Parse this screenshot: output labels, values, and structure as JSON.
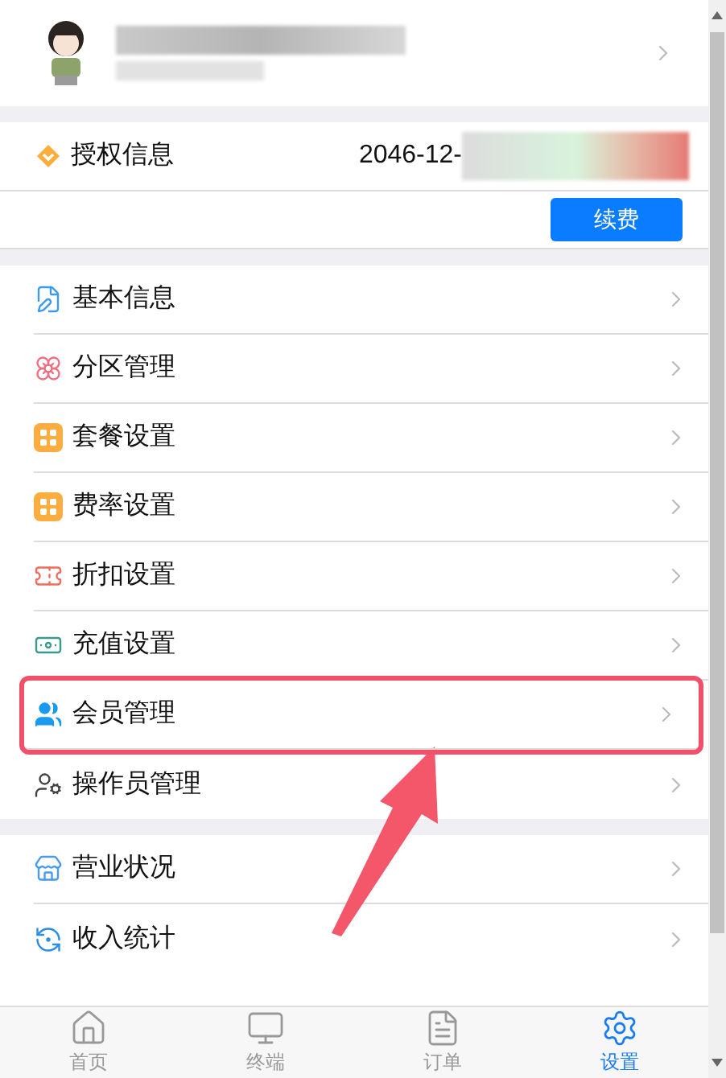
{
  "license": {
    "label": "授权信息",
    "expiry": "2046-12-",
    "button": "续费"
  },
  "menu_groups": [
    {
      "items": [
        {
          "label": "基本信息",
          "highlighted": false
        },
        {
          "label": "分区管理",
          "highlighted": false
        },
        {
          "label": "套餐设置",
          "highlighted": false
        },
        {
          "label": "费率设置",
          "highlighted": false
        },
        {
          "label": "折扣设置",
          "highlighted": false
        },
        {
          "label": "充值设置",
          "highlighted": false
        },
        {
          "label": "会员管理",
          "highlighted": true
        },
        {
          "label": "操作员管理",
          "highlighted": false
        }
      ]
    },
    {
      "items": [
        {
          "label": "营业状况",
          "highlighted": false
        },
        {
          "label": "收入统计",
          "highlighted": false
        }
      ]
    }
  ],
  "tabs": [
    {
      "label": "首页",
      "selected": false
    },
    {
      "label": "终端",
      "selected": false
    },
    {
      "label": "订单",
      "selected": false
    },
    {
      "label": "设置",
      "selected": true
    }
  ]
}
